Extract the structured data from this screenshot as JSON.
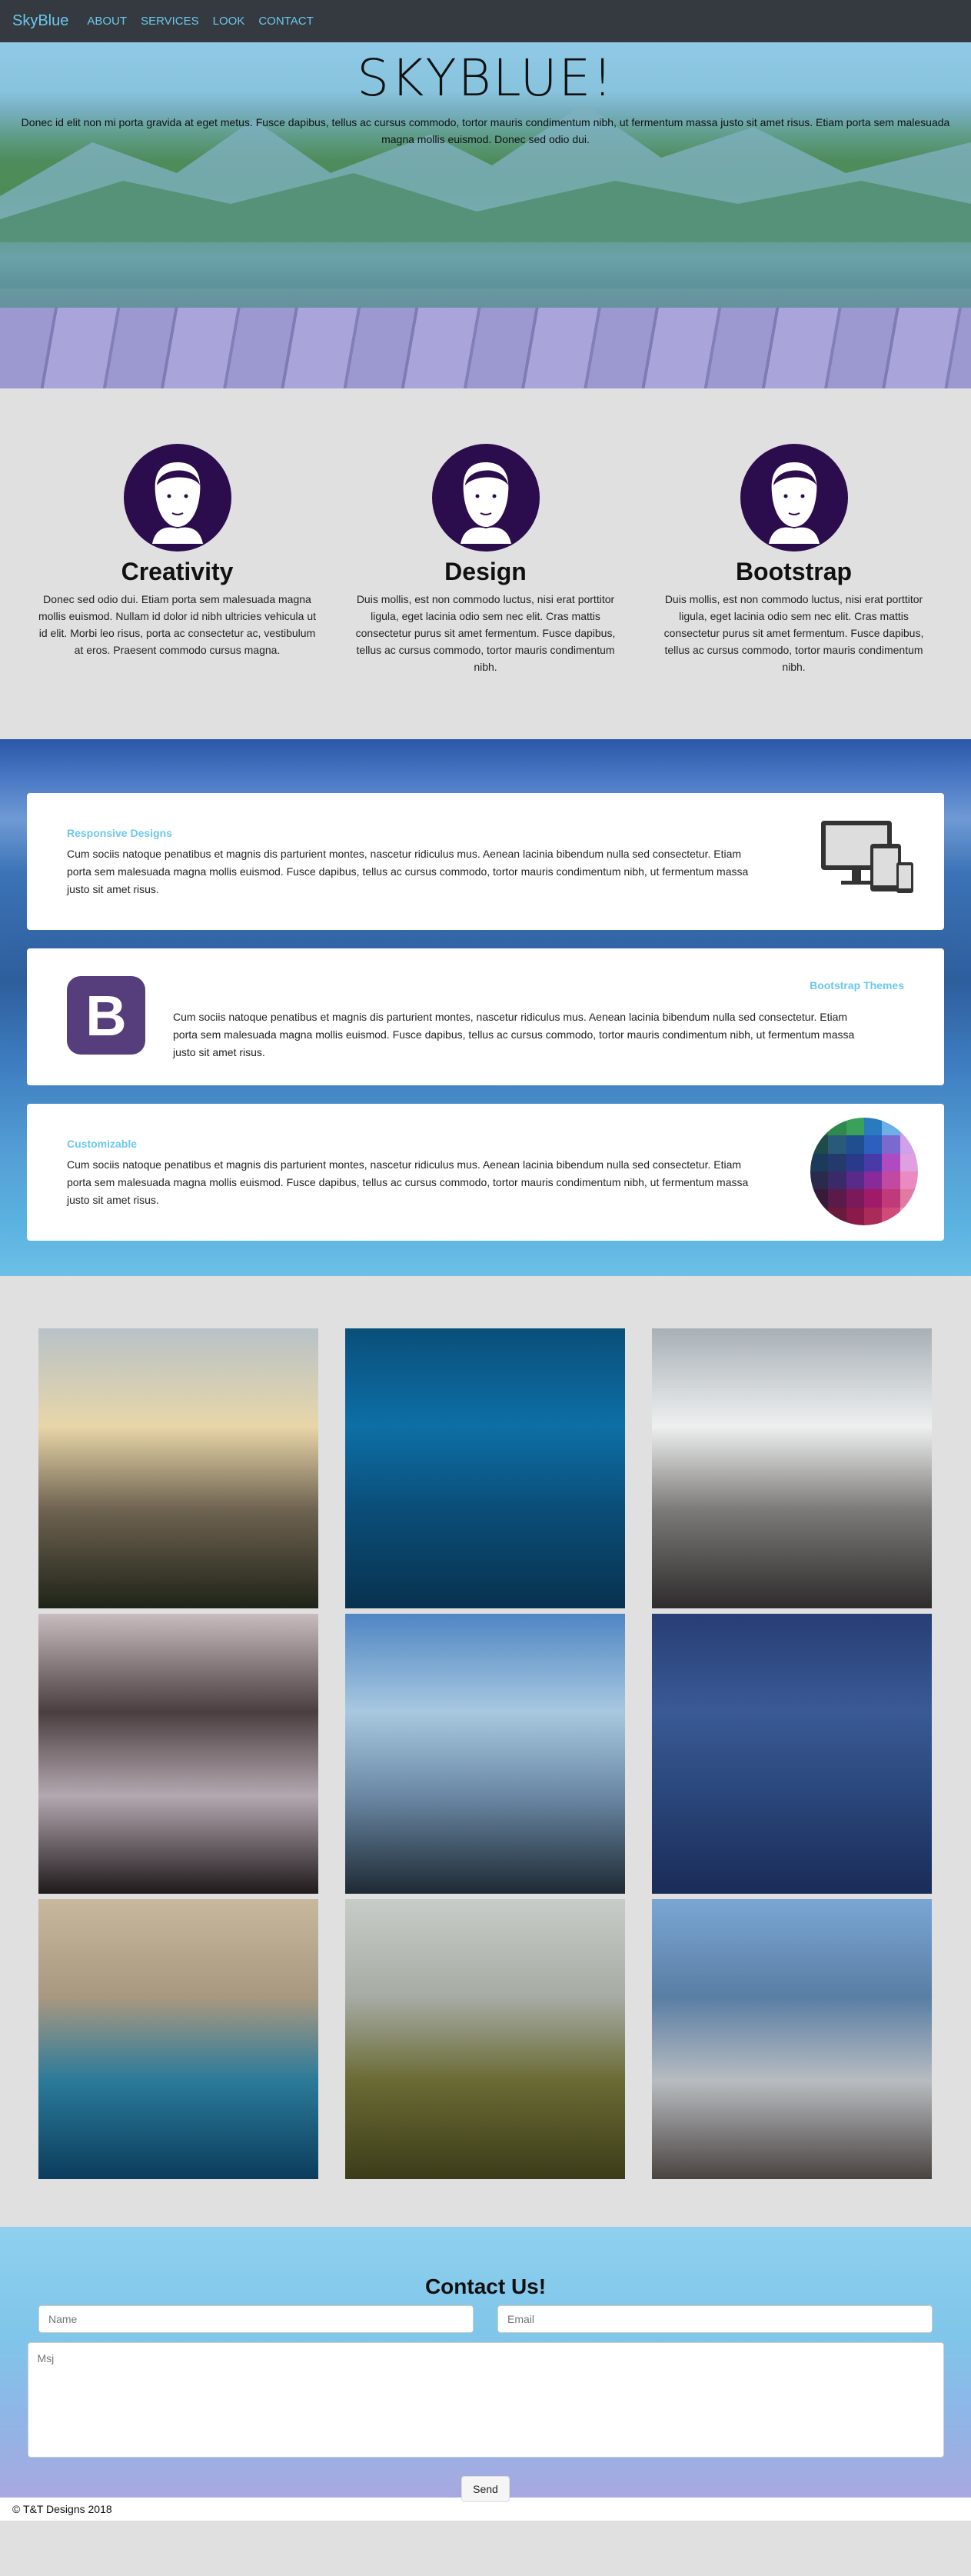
{
  "nav": {
    "brand": "SkyBlue",
    "links": [
      "ABOUT",
      "SERVICES",
      "LOOK",
      "CONTACT"
    ]
  },
  "hero": {
    "title": "SKYBLUE!",
    "text": "Donec id elit non mi porta gravida at eget metus. Fusce dapibus, tellus ac cursus commodo, tortor mauris condimentum nibh, ut fermentum massa justo sit amet risus. Etiam porta sem malesuada magna mollis euismod. Donec sed odio dui."
  },
  "features": [
    {
      "title": "Creativity",
      "text": "Donec sed odio dui. Etiam porta sem malesuada magna mollis euismod. Nullam id dolor id nibh ultricies vehicula ut id elit. Morbi leo risus, porta ac consectetur ac, vestibulum at eros. Praesent commodo cursus magna."
    },
    {
      "title": "Design",
      "text": "Duis mollis, est non commodo luctus, nisi erat porttitor ligula, eget lacinia odio sem nec elit. Cras mattis consectetur purus sit amet fermentum. Fusce dapibus, tellus ac cursus commodo, tortor mauris condimentum nibh."
    },
    {
      "title": "Bootstrap",
      "text": "Duis mollis, est non commodo luctus, nisi erat porttitor ligula, eget lacinia odio sem nec elit. Cras mattis consectetur purus sit amet fermentum. Fusce dapibus, tellus ac cursus commodo, tortor mauris condimentum nibh."
    }
  ],
  "cards": [
    {
      "title": "Responsive Designs",
      "text": "Cum sociis natoque penatibus et magnis dis parturient montes, nascetur ridiculus mus. Aenean lacinia bibendum nulla sed consectetur. Etiam porta sem malesuada magna mollis euismod. Fusce dapibus, tellus ac cursus commodo, tortor mauris condimentum nibh, ut fermentum massa justo sit amet risus.",
      "icon": "devices-icon"
    },
    {
      "title": "Bootstrap Themes",
      "text": "Cum sociis natoque penatibus et magnis dis parturient montes, nascetur ridiculus mus. Aenean lacinia bibendum nulla sed consectetur. Etiam porta sem malesuada magna mollis euismod. Fusce dapibus, tellus ac cursus commodo, tortor mauris condimentum nibh, ut fermentum massa justo sit amet risus.",
      "icon": "bootstrap-logo-icon",
      "logo_letter": "B"
    },
    {
      "title": "Customizable",
      "text": "Cum sociis natoque penatibus et magnis dis parturient montes, nascetur ridiculus mus. Aenean lacinia bibendum nulla sed consectetur. Etiam porta sem malesuada magna mollis euismod. Fusce dapibus, tellus ac cursus commodo, tortor mauris condimentum nibh, ut fermentum massa justo sit amet risus.",
      "icon": "color-palette-icon"
    }
  ],
  "gallery": [
    {
      "name": "sunset-valley-photo",
      "colors": [
        "#b8c2c8",
        "#e8d6a8",
        "#6e6250",
        "#1f2418"
      ]
    },
    {
      "name": "underwater-photo",
      "colors": [
        "#0a4f7a",
        "#0d6fa6",
        "#0b4d78",
        "#08324f"
      ]
    },
    {
      "name": "city-sun-photo",
      "colors": [
        "#a8b0b6",
        "#eef0f0",
        "#7c7a78",
        "#2e2c2c"
      ]
    },
    {
      "name": "forest-lake-photo",
      "colors": [
        "#c8bcc0",
        "#4a3e40",
        "#b4a8b0",
        "#201a1c"
      ]
    },
    {
      "name": "ocean-rocks-photo",
      "colors": [
        "#4f86c4",
        "#a8c8e0",
        "#6a88a4",
        "#1e2a34"
      ]
    },
    {
      "name": "ocean-waves-photo",
      "colors": [
        "#283e74",
        "#3a5a96",
        "#2a467a",
        "#1a2c58"
      ]
    },
    {
      "name": "coastline-aerial-photo",
      "colors": [
        "#c8b89c",
        "#a89880",
        "#2a7a9a",
        "#0c3c5c"
      ]
    },
    {
      "name": "foggy-field-photo",
      "colors": [
        "#c8ccc8",
        "#a6aca4",
        "#6a6a34",
        "#3c3c1a"
      ]
    },
    {
      "name": "lake-pier-photo",
      "colors": [
        "#7aa6d4",
        "#5a7ea4",
        "#b8bcc0",
        "#4a4440"
      ]
    }
  ],
  "contact": {
    "title": "Contact Us!",
    "name_placeholder": "Name",
    "email_placeholder": "Email",
    "message_placeholder": "Msj",
    "send_label": "Send"
  },
  "footer": {
    "text": "© T&T Designs 2018"
  },
  "colors": {
    "accent": "#6cc8ec",
    "navbar": "#343a40",
    "avatar": "#2b0c4d",
    "bootstrap": "#563d7c"
  }
}
